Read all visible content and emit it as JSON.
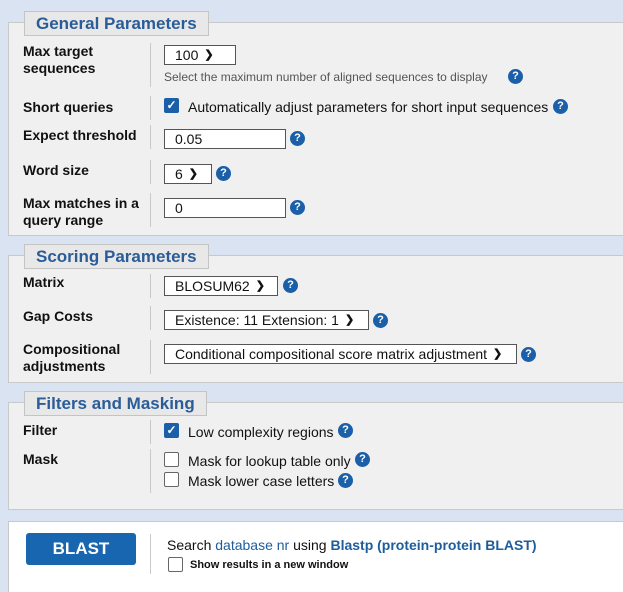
{
  "general": {
    "legend": "General Parameters",
    "max_target": {
      "label": "Max target sequences",
      "value": "100",
      "hint": "Select the maximum number of aligned sequences to display"
    },
    "short_queries": {
      "label": "Short queries",
      "checkbox_label": "Automatically adjust parameters for short input sequences",
      "checked": true
    },
    "expect": {
      "label": "Expect threshold",
      "value": "0.05"
    },
    "word_size": {
      "label": "Word size",
      "value": "6"
    },
    "max_matches": {
      "label": "Max matches in a query range",
      "value": "0"
    }
  },
  "scoring": {
    "legend": "Scoring Parameters",
    "matrix": {
      "label": "Matrix",
      "value": "BLOSUM62"
    },
    "gap_costs": {
      "label": "Gap Costs",
      "value": "Existence: 11 Extension: 1"
    },
    "compositional": {
      "label": "Compositional adjustments",
      "value": "Conditional compositional score matrix adjustment"
    }
  },
  "filters": {
    "legend": "Filters and Masking",
    "filter": {
      "label": "Filter",
      "low_complexity": "Low complexity regions",
      "checked": true
    },
    "mask": {
      "label": "Mask",
      "lookup_table": "Mask for lookup table only",
      "lower_case": "Mask lower case letters"
    }
  },
  "submit": {
    "button": "BLAST",
    "search_prefix": "Search",
    "database": "database nr",
    "using": "using",
    "program": "Blastp (protein-protein BLAST)",
    "new_window": "Show results in a new window"
  },
  "colors": {
    "accent": "#1a5fa8",
    "legend_text": "#2a5c98",
    "background": "#d9e3f2"
  },
  "icons": {
    "help": "question-circle-icon",
    "dropdown": "chevron-down-icon",
    "check": "checkmark-icon"
  }
}
